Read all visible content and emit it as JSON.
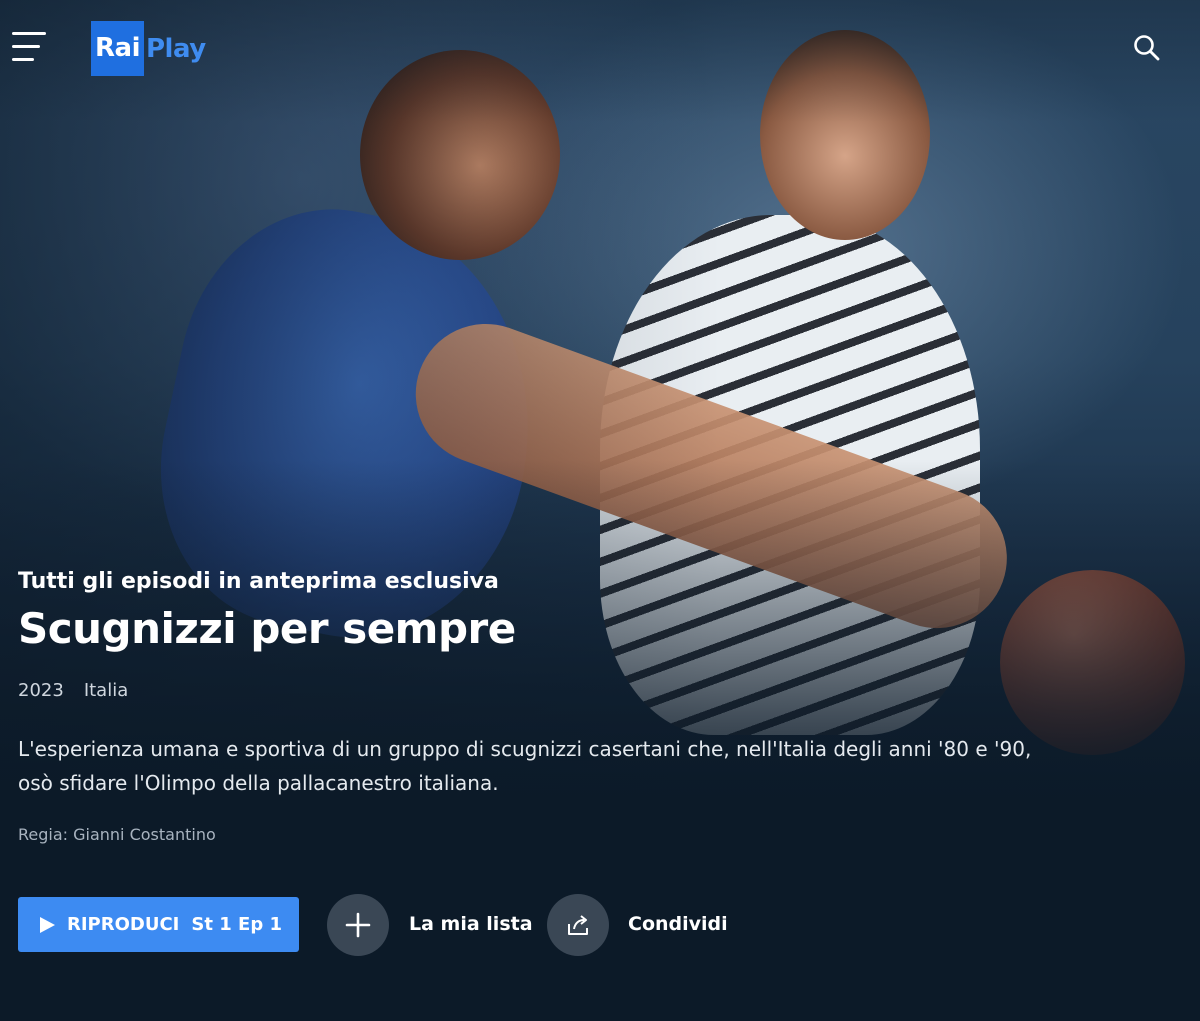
{
  "header": {
    "menu_icon": "hamburger-menu-icon",
    "logo": {
      "part1": "Rai",
      "part2": "Play",
      "color_primary": "#1f6fe0",
      "color_secondary": "#3f8cf0"
    },
    "search_icon": "search-icon"
  },
  "hero": {
    "subtitle": "Tutti gli episodi in anteprima esclusiva",
    "title": "Scugnizzi per sempre",
    "year": "2023",
    "country": "Italia",
    "description": "L'esperienza umana e sportiva di un gruppo di scugnizzi casertani che, nell'Italia degli anni '80 e '90, osò sfidare l'Olimpo della pallacanestro italiana.",
    "director": "Regia: Gianni Costantino"
  },
  "actions": {
    "play_label": "RIPRODUCI",
    "play_episode": "St 1 Ep 1",
    "play_icon": "play-icon",
    "add_label": "La mia lista",
    "add_icon": "plus-icon",
    "share_label": "Condividi",
    "share_icon": "share-icon"
  },
  "colors": {
    "background": "#0c1a28",
    "accent": "#3d8bf2",
    "round_button": "#3a4755"
  }
}
